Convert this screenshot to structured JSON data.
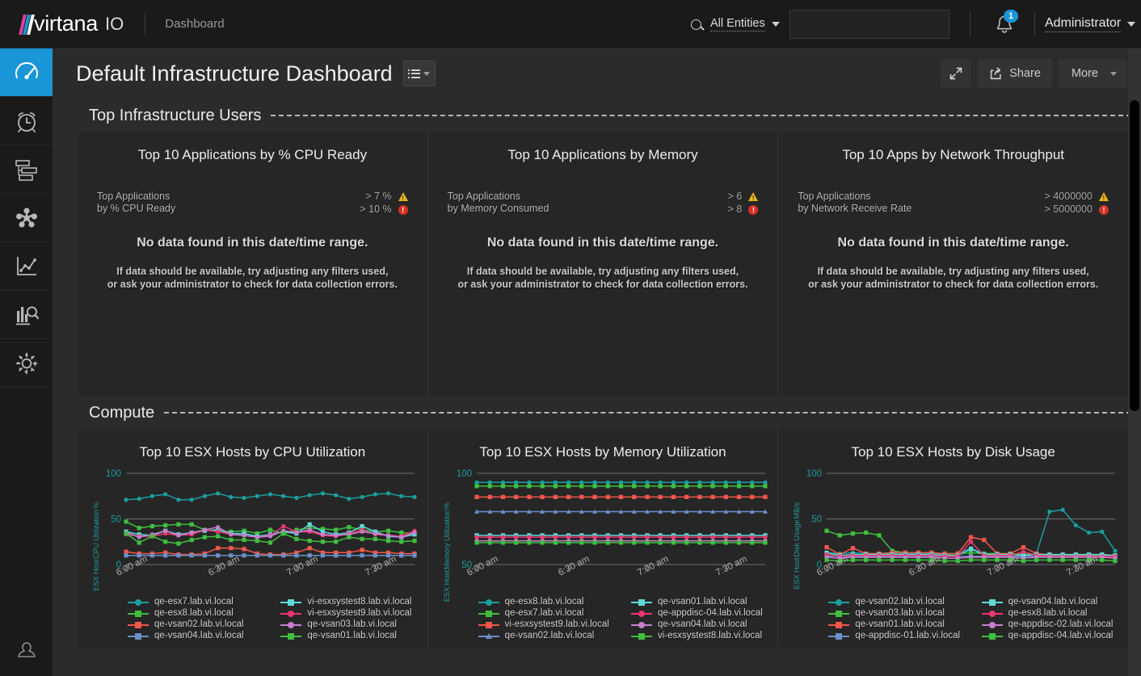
{
  "topbar": {
    "logo_virtana": "virtana",
    "logo_io": "IO",
    "logo_slash_colors": [
      "#e040a0",
      "#1896d8",
      "#ffffff"
    ],
    "breadcrumb": "Dashboard",
    "search_scope": "All Entities",
    "search_value": "",
    "search_placeholder": "",
    "search_icon": "search-icon",
    "notification_icon": "bell-icon",
    "notification_count": "1",
    "notification_badge_color": "#1896d8",
    "user_name": "Administrator"
  },
  "sidebar": {
    "items": [
      {
        "name": "dashboard",
        "icon": "gauge-icon",
        "active": true
      },
      {
        "name": "alarms",
        "icon": "alarm-clock-icon",
        "active": false
      },
      {
        "name": "topology",
        "icon": "stacked-bars-icon",
        "active": false
      },
      {
        "name": "infrastructure",
        "icon": "cluster-nodes-icon",
        "active": false
      },
      {
        "name": "trends",
        "icon": "line-chart-icon",
        "active": false
      },
      {
        "name": "reports",
        "icon": "bar-chart-search-icon",
        "active": false
      },
      {
        "name": "settings",
        "icon": "gear-icon",
        "active": false
      }
    ],
    "user_item": {
      "name": "profile",
      "icon": "user-icon"
    },
    "active_color": "#1896d8"
  },
  "page": {
    "title": "Default Infrastructure Dashboard",
    "view_select_icon": "list-menu-icon",
    "actions": {
      "expand_icon": "expand-arrows-icon",
      "share_icon": "share-icon",
      "share_label": "Share",
      "more_label": "More"
    }
  },
  "sections": [
    {
      "label": "Top Infrastructure Users",
      "panels": [
        {
          "title": "Top 10 Applications by % CPU Ready",
          "threshold_label_line1": "Top Applications",
          "threshold_label_line2": "by % CPU Ready",
          "warn_value": "> 7 %",
          "crit_value": "> 10 %",
          "nodata_title": "No data found in this date/time range.",
          "nodata_line1": "If data should be available, try adjusting any filters used,",
          "nodata_line2": "or ask your administrator to check for data collection errors."
        },
        {
          "title": "Top 10 Applications by Memory",
          "threshold_label_line1": "Top Applications",
          "threshold_label_line2": "by Memory Consumed",
          "warn_value": "> 6",
          "crit_value": "> 8",
          "nodata_title": "No data found in this date/time range.",
          "nodata_line1": "If data should be available, try adjusting any filters used,",
          "nodata_line2": "or ask your administrator to check for data collection errors."
        },
        {
          "title": "Top 10 Apps by Network Throughput",
          "threshold_label_line1": "Top Applications",
          "threshold_label_line2": "by Network Receive Rate",
          "warn_value": "> 4000000",
          "crit_value": "> 5000000",
          "nodata_title": "No data found in this date/time range.",
          "nodata_line1": "If data should be available, try adjusting any filters used,",
          "nodata_line2": "or ask your administrator to check for data collection errors."
        }
      ]
    },
    {
      "label": "Compute",
      "panels": [
        {
          "title": "Top 10 ESX Hosts by CPU Utilization"
        },
        {
          "title": "Top 10 ESX Hosts by Memory Utilization"
        },
        {
          "title": "Top 10 ESX Hosts by Disk Usage"
        }
      ]
    }
  ],
  "chart_data": [
    {
      "type": "line",
      "title": "Top 10 ESX Hosts by CPU Utilization",
      "ylabel_lines": [
        "ESX Host",
        "CPU Utilization",
        "%"
      ],
      "ylabel": "ESX Host CPU Utilization %",
      "xlabel": "",
      "ylim": [
        0,
        100
      ],
      "yticks": [
        0,
        50,
        100
      ],
      "grid": true,
      "legend_position": "bottom",
      "x": [
        "6:00 am",
        "6:30 am",
        "7:00 am",
        "7:30 am"
      ],
      "xtick_labels": [
        "6:00 am",
        "6:30 am",
        "7:00 am",
        "7:30 am"
      ],
      "series": [
        {
          "name": "qe-esx7.lab.vi.local",
          "color": "#1b9e9e",
          "symbol": "circle",
          "values": [
            71,
            72,
            75,
            77,
            71,
            71,
            75,
            78,
            74,
            73,
            75,
            77,
            75,
            73,
            76,
            78,
            76,
            72,
            74,
            77,
            78,
            75,
            74
          ]
        },
        {
          "name": "qe-esx8.lab.vi.local",
          "color": "#3fbf3f",
          "symbol": "square",
          "values": [
            47,
            40,
            42,
            43,
            44,
            44,
            38,
            37,
            36,
            37,
            34,
            38,
            34,
            38,
            40,
            39,
            38,
            41,
            38,
            36,
            37,
            35,
            34
          ]
        },
        {
          "name": "qe-vsan02.lab.vi.local",
          "color": "#f4564a",
          "symbol": "square",
          "values": [
            14,
            12,
            12,
            13,
            11,
            11,
            12,
            18,
            18,
            17,
            12,
            11,
            11,
            13,
            18,
            13,
            13,
            13,
            16,
            13,
            13,
            12,
            12
          ]
        },
        {
          "name": "qe-vsan04.lab.vi.local",
          "color": "#6a8fc9",
          "symbol": "square",
          "values": [
            10,
            10,
            10,
            10,
            10,
            10,
            10,
            10,
            10,
            10,
            10,
            10,
            10,
            10,
            10,
            10,
            10,
            10,
            10,
            10,
            10,
            10,
            10
          ]
        },
        {
          "name": "vi-esxsystest8.lab.vi.local",
          "color": "#5fd8d8",
          "symbol": "square",
          "values": [
            36,
            33,
            32,
            37,
            33,
            35,
            37,
            38,
            34,
            34,
            31,
            33,
            36,
            34,
            44,
            36,
            33,
            35,
            42,
            36,
            31,
            30,
            33
          ]
        },
        {
          "name": "vi-esxsystest9.lab.vi.local",
          "color": "#f0356f",
          "symbol": "circle",
          "values": [
            33,
            31,
            31,
            34,
            32,
            33,
            38,
            36,
            33,
            32,
            30,
            32,
            42,
            36,
            36,
            32,
            31,
            34,
            38,
            33,
            32,
            31,
            37
          ]
        },
        {
          "name": "qe-vsan03.lab.vi.local",
          "color": "#c77fd0",
          "symbol": "circle",
          "values": [
            35,
            30,
            33,
            37,
            32,
            35,
            38,
            41,
            33,
            32,
            30,
            31,
            37,
            35,
            38,
            33,
            32,
            33,
            36,
            34,
            32,
            30,
            35
          ]
        },
        {
          "name": "qe-vsan01.lab.vi.local",
          "color": "#3fbf3f",
          "symbol": "square",
          "values": [
            34,
            24,
            31,
            25,
            23,
            27,
            30,
            31,
            27,
            27,
            26,
            24,
            34,
            28,
            26,
            25,
            25,
            30,
            28,
            28,
            26,
            25,
            26
          ]
        }
      ]
    },
    {
      "type": "line",
      "title": "Top 10 ESX Hosts by Memory Utilization",
      "ylabel_lines": [
        "ESX Host",
        "Memory Utilization",
        "%"
      ],
      "ylabel": "ESX Host Memory Utilization %",
      "xlabel": "",
      "ylim": [
        50,
        100
      ],
      "yticks": [
        50,
        100
      ],
      "grid": true,
      "legend_position": "bottom",
      "x": [
        "6:00 am",
        "6:30 am",
        "7:00 am",
        "7:30 am"
      ],
      "xtick_labels": [
        "6:00 am",
        "6:30 am",
        "7:00 am",
        "7:30 am"
      ],
      "series": [
        {
          "name": "qe-esx8.lab.vi.local",
          "color": "#1b9e9e",
          "symbol": "circle",
          "constant": 95
        },
        {
          "name": "qe-esx7.lab.vi.local",
          "color": "#3fbf3f",
          "symbol": "square",
          "constant": 93
        },
        {
          "name": "vi-esxsystest9.lab.vi.local",
          "color": "#f4564a",
          "symbol": "square",
          "constant": 87
        },
        {
          "name": "qe-vsan02.lab.vi.local",
          "color": "#6a8fc9",
          "symbol": "triangle",
          "constant": 79
        },
        {
          "name": "qe-vsan01.lab.vi.local",
          "color": "#5fd8d8",
          "symbol": "square",
          "constant": 66
        },
        {
          "name": "qe-appdisc-04.lab.vi.local",
          "color": "#f0356f",
          "symbol": "circle",
          "constant": 65
        },
        {
          "name": "qe-vsan04.lab.vi.local",
          "color": "#c77fd0",
          "symbol": "circle",
          "constant": 63
        },
        {
          "name": "vi-esxsystest8.lab.vi.local",
          "color": "#3fbf3f",
          "symbol": "square",
          "constant": 62
        }
      ]
    },
    {
      "type": "line",
      "title": "Top 10 ESX Hosts by Disk Usage",
      "ylabel_lines": [
        "ESX Host",
        "Disk Usage",
        "MB/s"
      ],
      "ylabel": "ESX Host Disk Usage MB/s",
      "xlabel": "",
      "ylim": [
        0,
        100
      ],
      "yticks": [
        0,
        50,
        100
      ],
      "grid": true,
      "legend_position": "bottom",
      "x": [
        "6:00 am",
        "6:30 am",
        "7:00 am",
        "7:30 am"
      ],
      "xtick_labels": [
        "6:00 am",
        "6:30 am",
        "7:00 am",
        "7:30 am"
      ],
      "series": [
        {
          "name": "qe-vsan02.lab.vi.local",
          "color": "#1b9e9e",
          "symbol": "circle",
          "values": [
            13,
            12,
            13,
            12,
            12,
            12,
            12,
            12,
            12,
            11,
            12,
            18,
            12,
            12,
            12,
            11,
            12,
            58,
            60,
            43,
            35,
            36,
            15
          ]
        },
        {
          "name": "qe-vsan03.lab.vi.local",
          "color": "#3fbf3f",
          "symbol": "square",
          "values": [
            37,
            32,
            34,
            35,
            32,
            15,
            13,
            13,
            13,
            12,
            12,
            13,
            12,
            12,
            12,
            11,
            11,
            10,
            10,
            10,
            10,
            10,
            10
          ]
        },
        {
          "name": "qe-vsan01.lab.vi.local",
          "color": "#f4564a",
          "symbol": "square",
          "values": [
            19,
            11,
            18,
            12,
            12,
            13,
            13,
            13,
            13,
            12,
            12,
            30,
            27,
            12,
            12,
            19,
            12,
            11,
            11,
            11,
            11,
            11,
            10
          ]
        },
        {
          "name": "qe-appdisc-01.lab.vi.local",
          "color": "#6a8fc9",
          "symbol": "square",
          "values": [
            9,
            9,
            9,
            9,
            9,
            9,
            9,
            9,
            9,
            9,
            9,
            9,
            9,
            9,
            9,
            9,
            9,
            9,
            9,
            9,
            9,
            9,
            9
          ]
        },
        {
          "name": "qe-vsan04.lab.vi.local",
          "color": "#5fd8d8",
          "symbol": "square",
          "values": [
            13,
            10,
            11,
            11,
            11,
            11,
            11,
            11,
            11,
            10,
            10,
            17,
            11,
            11,
            11,
            10,
            11,
            11,
            11,
            11,
            11,
            11,
            10
          ]
        },
        {
          "name": "qe-esx8.lab.vi.local",
          "color": "#f0356f",
          "symbol": "circle",
          "values": [
            11,
            9,
            10,
            10,
            10,
            10,
            10,
            10,
            10,
            9,
            9,
            25,
            10,
            10,
            10,
            14,
            10,
            9,
            9,
            9,
            9,
            9,
            9
          ]
        },
        {
          "name": "qe-appdisc-02.lab.vi.local",
          "color": "#c77fd0",
          "symbol": "circle",
          "values": [
            8,
            7,
            8,
            8,
            8,
            8,
            8,
            8,
            8,
            7,
            7,
            8,
            8,
            8,
            8,
            7,
            8,
            8,
            8,
            8,
            8,
            8,
            7
          ]
        },
        {
          "name": "qe-appdisc-04.lab.vi.local",
          "color": "#3fbf3f",
          "symbol": "square",
          "values": [
            5,
            4,
            5,
            5,
            5,
            5,
            5,
            5,
            5,
            4,
            4,
            5,
            5,
            5,
            5,
            4,
            5,
            5,
            5,
            5,
            5,
            5,
            4
          ]
        }
      ]
    }
  ]
}
